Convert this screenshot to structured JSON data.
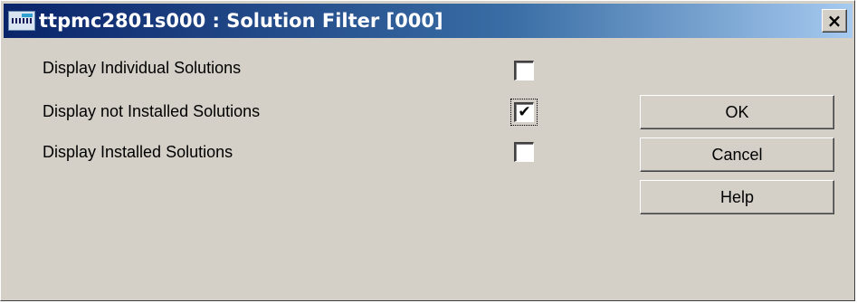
{
  "window": {
    "title": "ttpmc2801s000 : Solution Filter [000]",
    "close_label": "×"
  },
  "options": [
    {
      "label": "Display Individual Solutions",
      "checked": false,
      "mark": ""
    },
    {
      "label": "Display not Installed Solutions",
      "checked": true,
      "mark": "✔"
    },
    {
      "label": "Display Installed Solutions",
      "checked": false,
      "mark": ""
    }
  ],
  "buttons": {
    "ok_label": "OK",
    "cancel_label": "Cancel",
    "help_label": "Help"
  },
  "colors": {
    "titlebar_start": "#0a246a",
    "titlebar_end": "#a6caf0",
    "face": "#d4d0c8"
  }
}
